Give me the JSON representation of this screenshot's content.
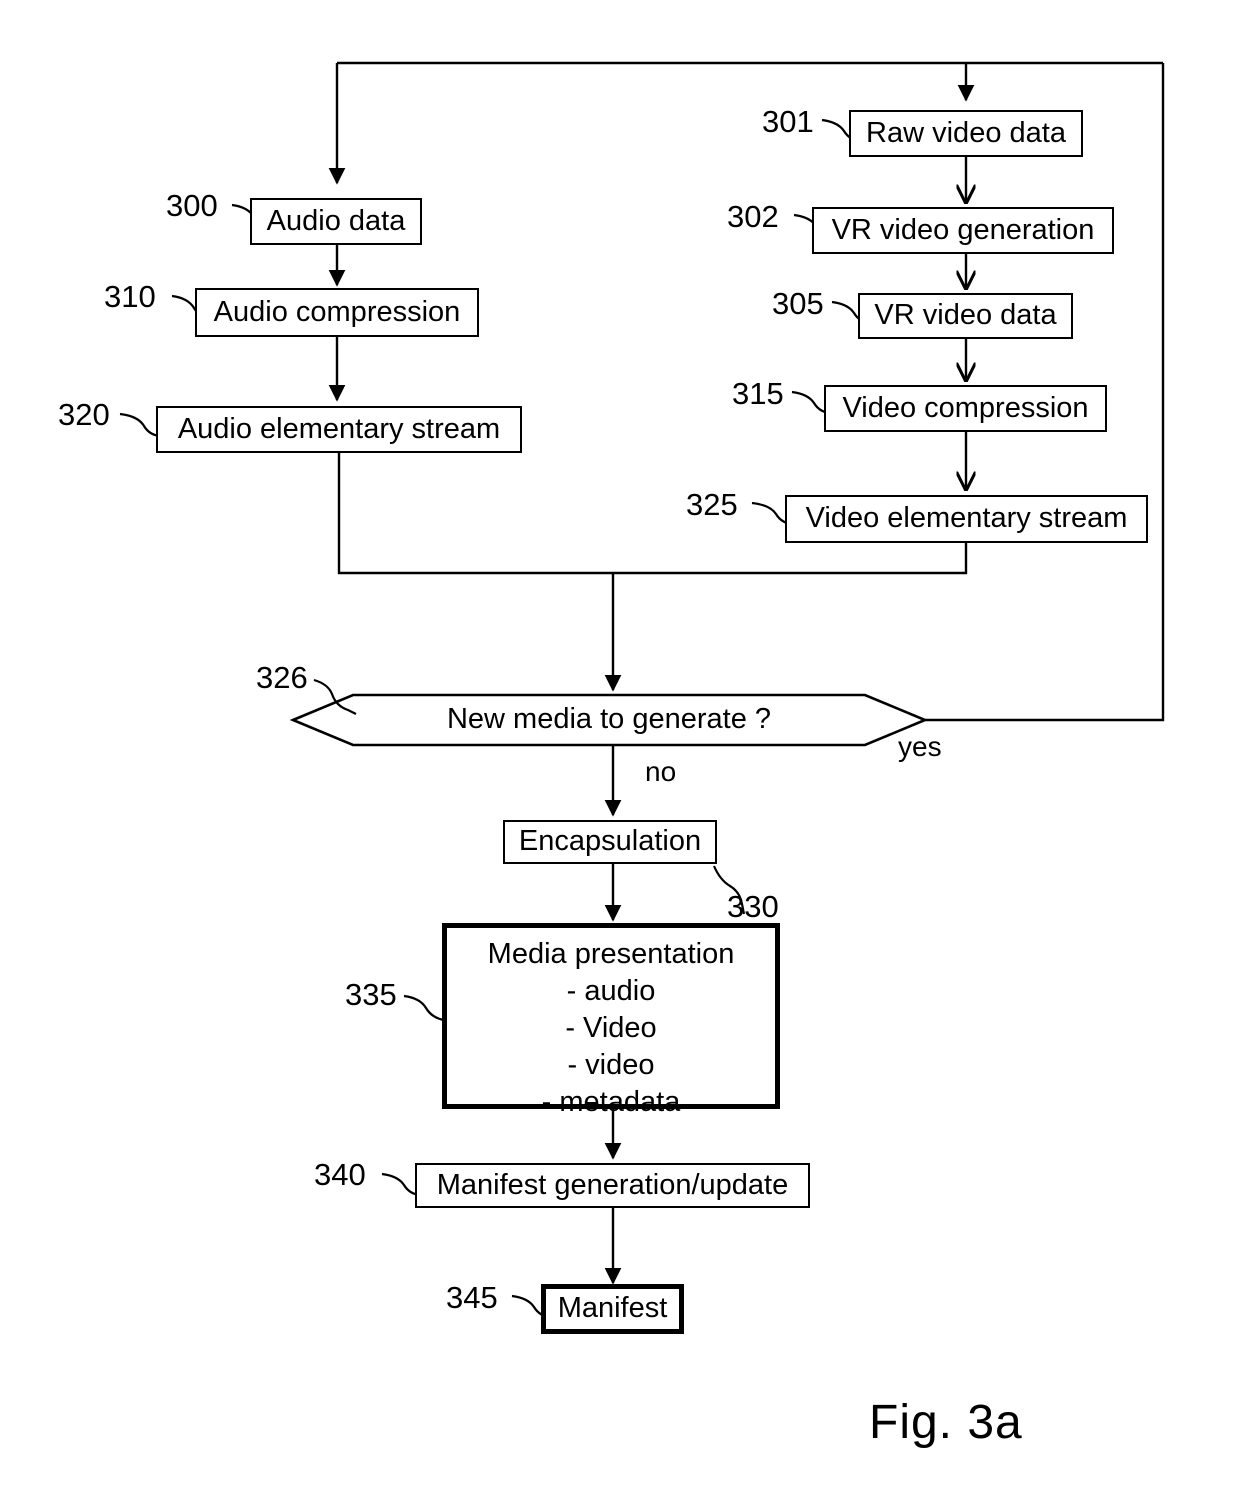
{
  "figure": {
    "caption": "Fig. 3a",
    "decision_labels": {
      "yes": "yes",
      "no": "no"
    }
  },
  "nodes": {
    "audio_data": {
      "ref": "300",
      "label": "Audio data"
    },
    "raw_video_data": {
      "ref": "301",
      "label": "Raw video data"
    },
    "vr_video_generation": {
      "ref": "302",
      "label": "VR video generation"
    },
    "vr_video_data": {
      "ref": "305",
      "label": "VR video data"
    },
    "audio_compression": {
      "ref": "310",
      "label": "Audio compression"
    },
    "video_compression": {
      "ref": "315",
      "label": "Video compression"
    },
    "audio_elementary_stream": {
      "ref": "320",
      "label": "Audio elementary stream"
    },
    "video_elementary_stream": {
      "ref": "325",
      "label": "Video elementary stream"
    },
    "new_media_decision": {
      "ref": "326",
      "label": "New media to generate ?"
    },
    "encapsulation": {
      "ref": "330",
      "label": "Encapsulation"
    },
    "media_presentation": {
      "ref": "335",
      "title": "Media presentation",
      "items": [
        "-  audio",
        "-  Video",
        "-  video",
        "-  metadata"
      ]
    },
    "manifest_generation": {
      "ref": "340",
      "label": "Manifest generation/update"
    },
    "manifest": {
      "ref": "345",
      "label": "Manifest"
    }
  }
}
